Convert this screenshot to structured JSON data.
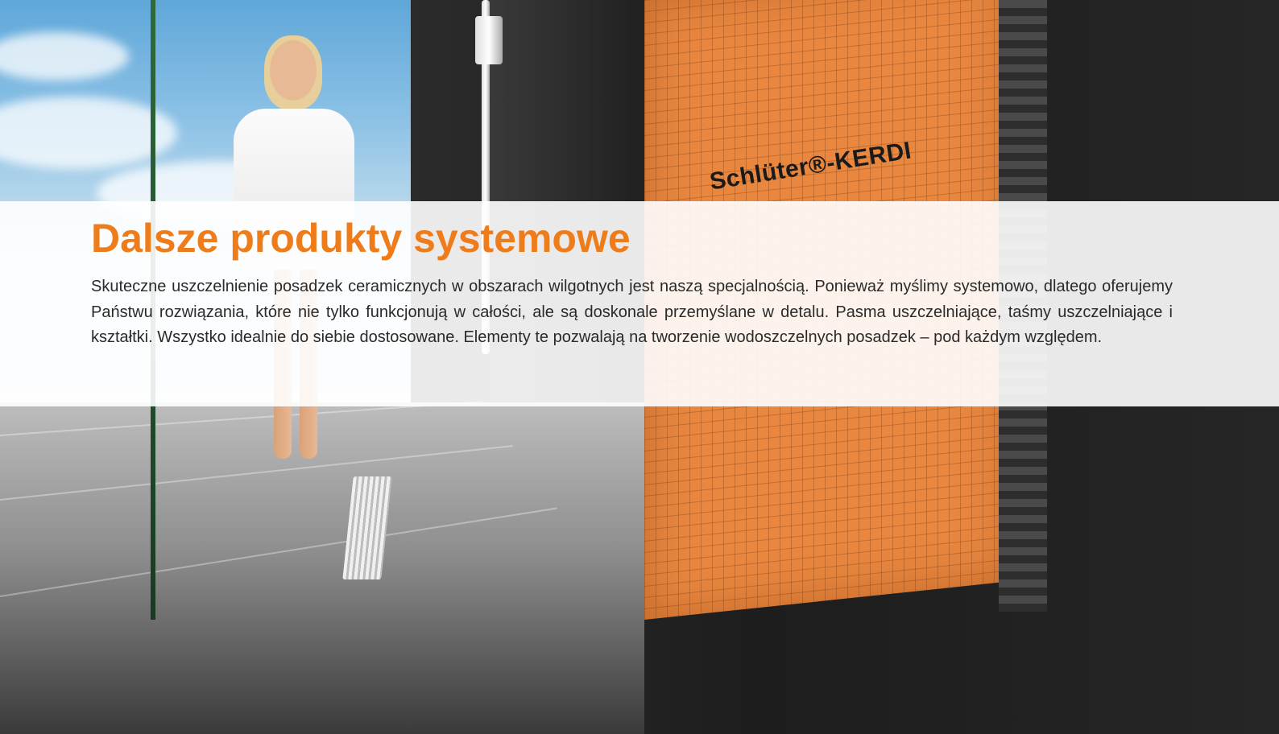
{
  "colors": {
    "accent": "#ee7c1a",
    "body_text": "#2a2a2a",
    "panel": "#ffffff"
  },
  "background": {
    "membrane_brand": "Schlüter®-KERDI"
  },
  "title": "Dalsze produkty systemowe",
  "paragraph": "Skuteczne uszczelnienie posadzek ceramicznych w obszarach wilgotnych jest naszą specjalnością. Ponieważ myślimy systemowo, dlatego oferujemy Państwu rozwiązania, które nie tylko funkcjonują w całości, ale są doskonale przemyślane w detalu. Pasma uszczelniające, taśmy uszczelniające i kształtki. Wszystko idealnie do siebie dostosowane. Elementy te pozwalają na tworzenie wodoszczelnych posadzek – pod każdym względem."
}
